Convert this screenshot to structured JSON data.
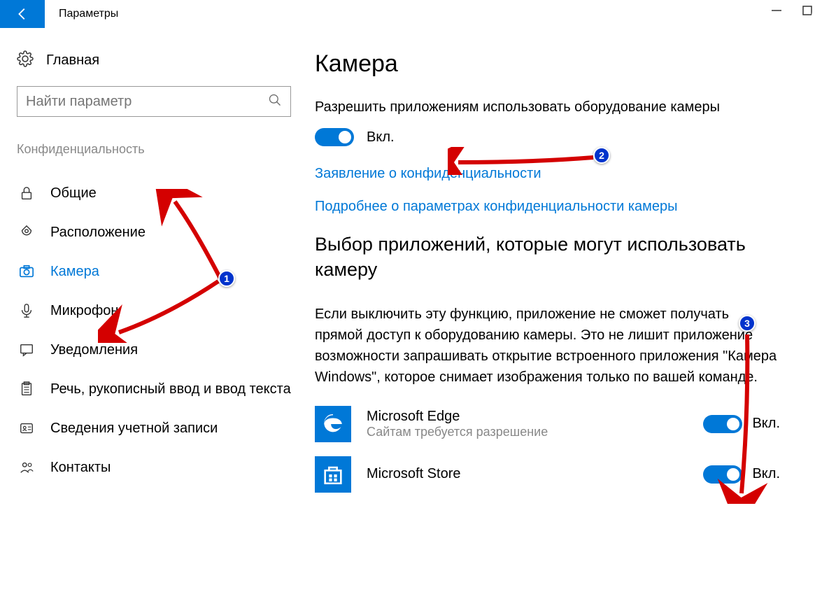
{
  "window": {
    "title": "Параметры"
  },
  "sidebar": {
    "home": "Главная",
    "search_placeholder": "Найти параметр",
    "section": "Конфиденциальность",
    "items": [
      {
        "label": "Общие",
        "icon": "lock-icon"
      },
      {
        "label": "Расположение",
        "icon": "location-icon"
      },
      {
        "label": "Камера",
        "icon": "camera-icon",
        "active": true
      },
      {
        "label": "Микрофон",
        "icon": "microphone-icon"
      },
      {
        "label": "Уведомления",
        "icon": "message-icon"
      },
      {
        "label": "Речь, рукописный ввод и ввод текста",
        "icon": "clipboard-icon"
      },
      {
        "label": "Сведения учетной записи",
        "icon": "account-icon"
      },
      {
        "label": "Контакты",
        "icon": "contacts-icon"
      }
    ]
  },
  "content": {
    "title": "Камера",
    "allow_label": "Разрешить приложениям использовать оборудование камеры",
    "allow_state": "Вкл.",
    "privacy_link": "Заявление о конфиденциальности",
    "learn_link": "Подробнее о параметрах конфиденциальности камеры",
    "choose_heading": "Выбор приложений, которые могут использовать камеру",
    "choose_desc": "Если выключить эту функцию, приложение не сможет получать прямой доступ к оборудованию камеры. Это не лишит приложение возможности запрашивать открытие встроенного приложения \"Камера Windows\", которое снимает изображения только по вашей команде.",
    "apps": [
      {
        "name": "Microsoft Edge",
        "sub": "Сайтам требуется разрешение",
        "state": "Вкл."
      },
      {
        "name": "Microsoft Store",
        "sub": "",
        "state": "Вкл."
      }
    ]
  },
  "annotations": {
    "badges": [
      "1",
      "2",
      "3"
    ]
  }
}
